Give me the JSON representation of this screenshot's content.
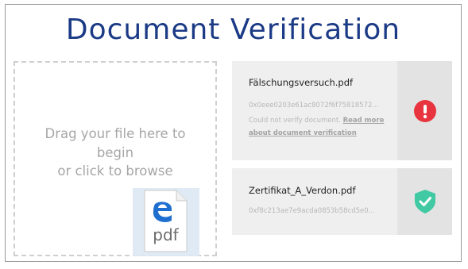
{
  "title": "Document Verification",
  "dropzone": {
    "line1": "Drag your file here to",
    "line2": "begin",
    "line3": "or click to browse",
    "file_icon_label": "pdf"
  },
  "documents": [
    {
      "name": "Fälschungsversuch.pdf",
      "hash": "0x0eee0203e61ac8072f6f75818572...",
      "message": "Could not verify document.",
      "link_text": "Read more about document verification",
      "status": "failed",
      "status_color": "#e8343f"
    },
    {
      "name": "Zertifikat_A_Verdon.pdf",
      "hash": "0xf8c213ae7e9acda0853b58cd5e0...",
      "status": "verified",
      "status_color": "#40c9a2"
    }
  ],
  "colors": {
    "title": "#1b3a86",
    "card_bg": "#efefef",
    "status_panel_bg": "#e3e3e3"
  },
  "icons": {
    "error": "exclamation-circle-icon",
    "verified": "shield-check-icon",
    "file": "edge-pdf-icon"
  }
}
